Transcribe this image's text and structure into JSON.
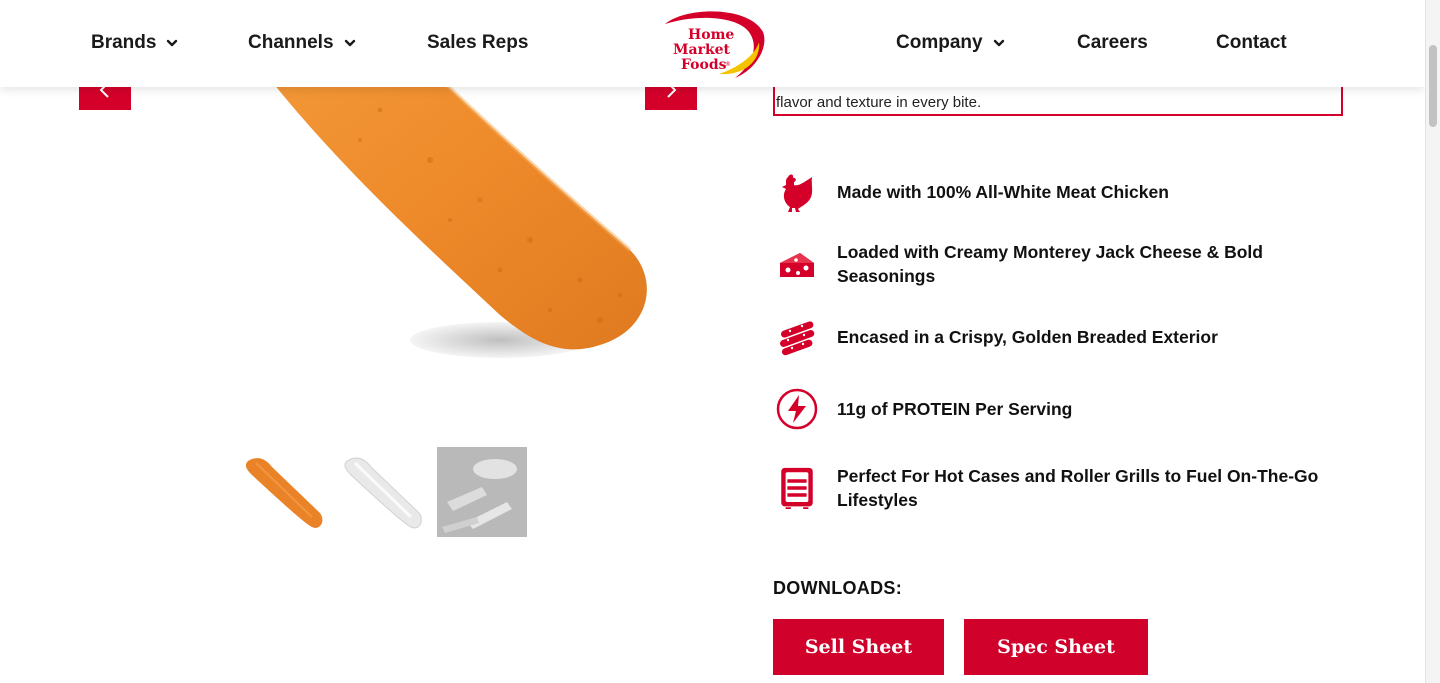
{
  "nav": {
    "left": [
      {
        "label": "Brands",
        "has_dropdown": true
      },
      {
        "label": "Channels",
        "has_dropdown": true
      },
      {
        "label": "Sales Reps",
        "has_dropdown": false
      }
    ],
    "right": [
      {
        "label": "Company",
        "has_dropdown": true
      },
      {
        "label": "Careers",
        "has_dropdown": false
      },
      {
        "label": "Contact",
        "has_dropdown": false
      }
    ],
    "logo": {
      "line1": "Home",
      "line2": "Market",
      "line3": "Foods",
      "mark": "®"
    }
  },
  "carousel": {
    "prev_icon": "chevron-left-icon",
    "next_icon": "chevron-right-icon",
    "thumbnails": [
      "breaded-stick-thumbnail",
      "white-stick-thumbnail",
      "serving-photo-thumbnail"
    ]
  },
  "description": {
    "visible_text": "flavor and texture in every bite."
  },
  "features": [
    {
      "icon": "chicken-icon",
      "text": "Made with 100% All-White Meat Chicken"
    },
    {
      "icon": "cheese-icon",
      "text": "Loaded with Creamy Monterey Jack Cheese & Bold Seasonings"
    },
    {
      "icon": "breaded-sticks-icon",
      "text": "Encased in a Crispy, Golden Breaded Exterior"
    },
    {
      "icon": "lightning-bolt-icon",
      "text": "11g of PROTEIN Per Serving"
    },
    {
      "icon": "hot-case-icon",
      "text": "Perfect For Hot Cases and Roller Grills to Fuel On-The-Go Lifestyles"
    }
  ],
  "downloads": {
    "label": "DOWNLOADS:",
    "buttons": [
      {
        "label": "Sell Sheet"
      },
      {
        "label": "Spec Sheet"
      }
    ]
  },
  "colors": {
    "brand_red": "#d4002a",
    "brand_yellow": "#f5c400",
    "text": "#111111"
  }
}
